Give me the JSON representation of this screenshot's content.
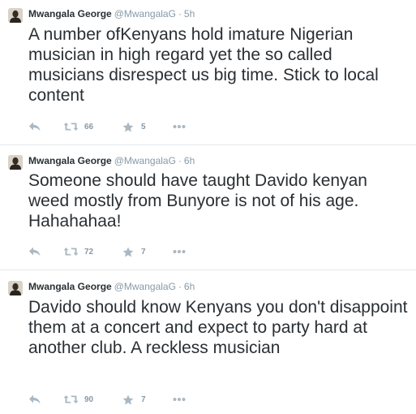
{
  "tweets": [
    {
      "name": "Mwangala George",
      "handle": "@MwangalaG",
      "separator": "·",
      "time": "5h",
      "text": "A number ofKenyans hold imature Nigerian musician in high regard yet the so called musicians disrespect us big time. Stick to local content",
      "retweets": "66",
      "favorites": "5"
    },
    {
      "name": "Mwangala George",
      "handle": "@MwangalaG",
      "separator": "·",
      "time": "6h",
      "text": "Someone should have taught Davido kenyan weed mostly from Bunyore is not of his age. Hahahahaa!",
      "retweets": "72",
      "favorites": "7"
    },
    {
      "name": "Mwangala George",
      "handle": "@MwangalaG",
      "separator": "·",
      "time": "6h",
      "text": "Davido should know Kenyans you don't disappoint them at a concert and expect to party hard at another club. A reckless musician",
      "retweets": "90",
      "favorites": "7"
    }
  ],
  "icons": {
    "reply": "reply-icon",
    "retweet": "retweet-icon",
    "favorite": "star-icon",
    "more": "more-icon"
  },
  "colors": {
    "text": "#292f33",
    "muted": "#8899a6",
    "divider": "#e1e8ed",
    "icon": "#aab8c2"
  }
}
